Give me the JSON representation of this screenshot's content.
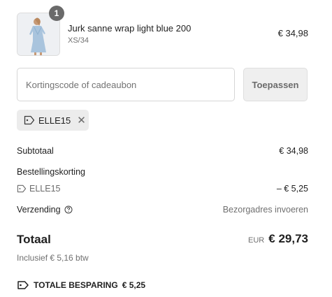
{
  "line_item": {
    "quantity": "1",
    "name": "Jurk sanne wrap light blue 200",
    "variant": "XS/34",
    "price": "€ 34,98",
    "image_icon": "product-photo-dress"
  },
  "discount": {
    "placeholder": "Kortingscode of cadeaubon",
    "value": "",
    "apply_label": "Toepassen",
    "applied_code": "ELLE15",
    "remove_symbol": "✕"
  },
  "summary": {
    "subtotal_label": "Subtotaal",
    "subtotal_value": "€ 34,98",
    "order_discount_label": "Bestellingskorting",
    "order_discount_code": "ELLE15",
    "order_discount_value": "– € 5,25",
    "shipping_label": "Verzending",
    "shipping_value": "Bezorgadres invoeren",
    "total_label": "Totaal",
    "currency": "EUR",
    "total_value": "€ 29,73",
    "tax_note": "Inclusief € 5,16 btw",
    "savings_label": "TOTALE BESPARING",
    "savings_value": "€ 5,25"
  },
  "colors": {
    "text": "#1f1f1f",
    "muted": "#707070",
    "chip_bg": "#ececec",
    "apply_bg": "#efefef",
    "dress_blue": "#a9c4dd"
  }
}
